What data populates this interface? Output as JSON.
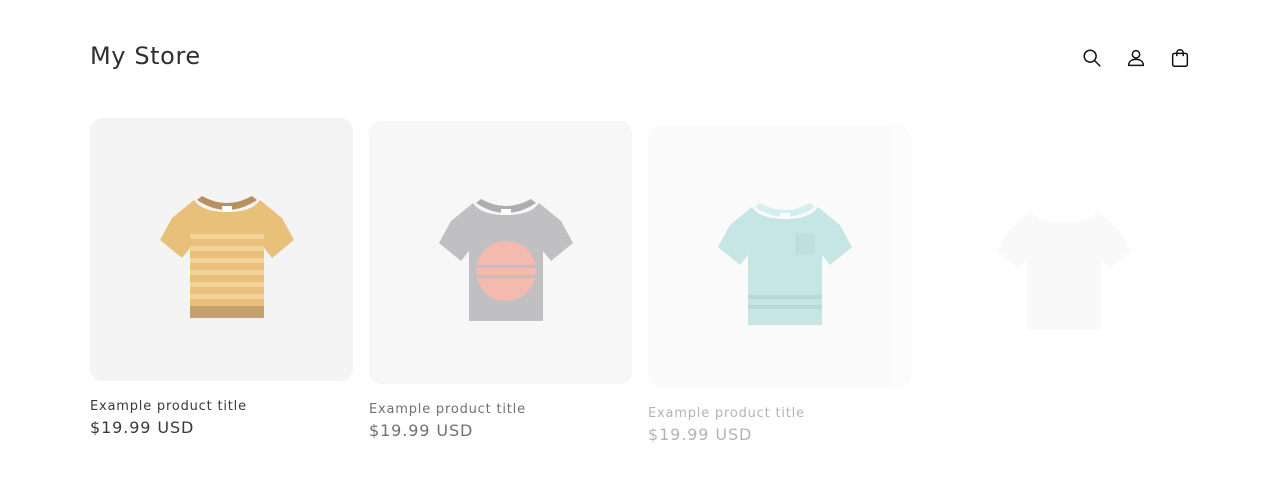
{
  "header": {
    "store_title": "My Store",
    "icons": [
      "search-icon",
      "account-icon",
      "cart-icon"
    ]
  },
  "products": [
    {
      "title": "Example product title",
      "price": "$19.99 USD",
      "shirt": "striped-orange"
    },
    {
      "title": "Example product title",
      "price": "$19.99 USD",
      "shirt": "grey-sunset"
    },
    {
      "title": "Example product title",
      "price": "$19.99 USD",
      "shirt": "teal-pocket"
    },
    {
      "title": "",
      "price": "",
      "shirt": "plain-light"
    }
  ],
  "colors": {
    "card_background": "#f4f4f4",
    "text": "#3a3a3a"
  }
}
